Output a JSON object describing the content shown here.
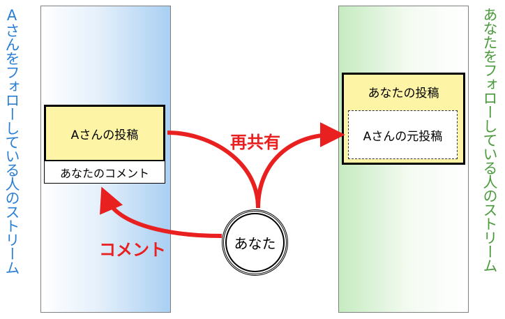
{
  "left_stream": {
    "label": "Aさんをフォローしている人のストリーム"
  },
  "right_stream": {
    "label": "あなたをフォローしている人のストリーム"
  },
  "a_post": {
    "text": "Aさんの投稿"
  },
  "your_comment": {
    "text": "あなたのコメント"
  },
  "your_post": {
    "title": "あなたの投稿",
    "original_post": "Aさんの元投稿"
  },
  "you": {
    "label": "あなた"
  },
  "arrows": {
    "reshare": "再共有",
    "comment": "コメント"
  },
  "colors": {
    "left_label": "#2a7fd4",
    "right_label": "#4a9a3c",
    "arrow": "#e8201f",
    "post_fill": "#fdf4a6"
  }
}
